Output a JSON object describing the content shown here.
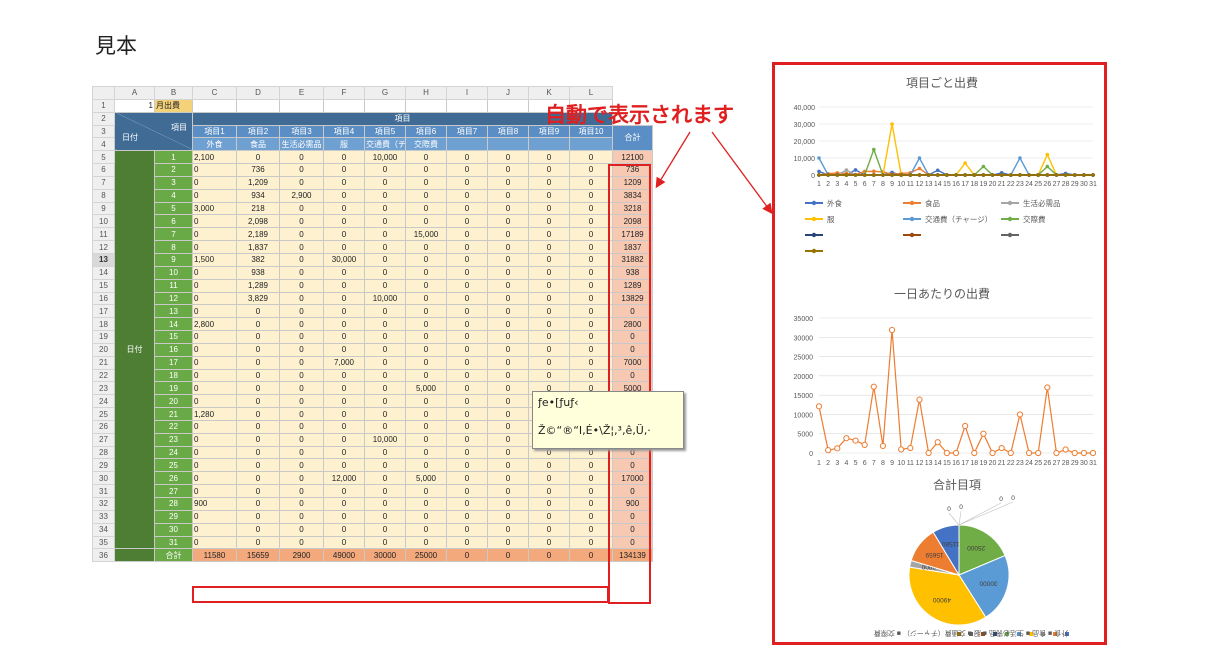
{
  "page_title": "見本",
  "annotation": "自動で表示されます",
  "sheet": {
    "col_headers": [
      "A",
      "B",
      "C",
      "D",
      "E",
      "F",
      "G",
      "H",
      "I",
      "J",
      "K",
      "L"
    ],
    "row1": {
      "a": "1",
      "b": "月出費"
    },
    "header": {
      "date": "日付",
      "item": "項目",
      "group": "項目",
      "total": "合計"
    },
    "items": [
      "項目1",
      "項目2",
      "項目3",
      "項目4",
      "項目5",
      "項目6",
      "項目7",
      "項目8",
      "項目9",
      "項目10"
    ],
    "item_names": [
      "外食",
      "食品",
      "生活必需品",
      "服",
      "交通費（チャージ）",
      "交際費",
      "",
      "",
      "",
      ""
    ],
    "side_label": "日付",
    "days": [
      {
        "row": "5",
        "day": "1",
        "v": [
          "2,100",
          "0",
          "0",
          "0",
          "10,000",
          "0",
          "0",
          "0",
          "0",
          "0"
        ],
        "total": "12100"
      },
      {
        "row": "6",
        "day": "2",
        "v": [
          "0",
          "736",
          "0",
          "0",
          "0",
          "0",
          "0",
          "0",
          "0",
          "0"
        ],
        "total": "736"
      },
      {
        "row": "7",
        "day": "3",
        "v": [
          "0",
          "1,209",
          "0",
          "0",
          "0",
          "0",
          "0",
          "0",
          "0",
          "0"
        ],
        "total": "1209"
      },
      {
        "row": "8",
        "day": "4",
        "v": [
          "0",
          "934",
          "2,900",
          "0",
          "0",
          "0",
          "0",
          "0",
          "0",
          "0"
        ],
        "total": "3834"
      },
      {
        "row": "9",
        "day": "5",
        "v": [
          "3,000",
          "218",
          "0",
          "0",
          "0",
          "0",
          "0",
          "0",
          "0",
          "0"
        ],
        "total": "3218"
      },
      {
        "row": "10",
        "day": "6",
        "v": [
          "0",
          "2,098",
          "0",
          "0",
          "0",
          "0",
          "0",
          "0",
          "0",
          "0"
        ],
        "total": "2098"
      },
      {
        "row": "11",
        "day": "7",
        "v": [
          "0",
          "2,189",
          "0",
          "0",
          "0",
          "15,000",
          "0",
          "0",
          "0",
          "0"
        ],
        "total": "17189"
      },
      {
        "row": "12",
        "day": "8",
        "v": [
          "0",
          "1,837",
          "0",
          "0",
          "0",
          "0",
          "0",
          "0",
          "0",
          "0"
        ],
        "total": "1837"
      },
      {
        "row": "13",
        "day": "9",
        "v": [
          "1,500",
          "382",
          "0",
          "30,000",
          "0",
          "0",
          "0",
          "0",
          "0",
          "0"
        ],
        "total": "31882"
      },
      {
        "row": "14",
        "day": "10",
        "v": [
          "0",
          "938",
          "0",
          "0",
          "0",
          "0",
          "0",
          "0",
          "0",
          "0"
        ],
        "total": "938"
      },
      {
        "row": "15",
        "day": "11",
        "v": [
          "0",
          "1,289",
          "0",
          "0",
          "0",
          "0",
          "0",
          "0",
          "0",
          "0"
        ],
        "total": "1289"
      },
      {
        "row": "16",
        "day": "12",
        "v": [
          "0",
          "3,829",
          "0",
          "0",
          "10,000",
          "0",
          "0",
          "0",
          "0",
          "0"
        ],
        "total": "13829"
      },
      {
        "row": "17",
        "day": "13",
        "v": [
          "0",
          "0",
          "0",
          "0",
          "0",
          "0",
          "0",
          "0",
          "0",
          "0"
        ],
        "total": "0"
      },
      {
        "row": "18",
        "day": "14",
        "v": [
          "2,800",
          "0",
          "0",
          "0",
          "0",
          "0",
          "0",
          "0",
          "0",
          "0"
        ],
        "total": "2800"
      },
      {
        "row": "19",
        "day": "15",
        "v": [
          "0",
          "0",
          "0",
          "0",
          "0",
          "0",
          "0",
          "0",
          "0",
          "0"
        ],
        "total": "0"
      },
      {
        "row": "20",
        "day": "16",
        "v": [
          "0",
          "0",
          "0",
          "0",
          "0",
          "0",
          "0",
          "0",
          "0",
          "0"
        ],
        "total": "0"
      },
      {
        "row": "21",
        "day": "17",
        "v": [
          "0",
          "0",
          "0",
          "7,000",
          "0",
          "0",
          "0",
          "0",
          "0",
          "0"
        ],
        "total": "7000"
      },
      {
        "row": "22",
        "day": "18",
        "v": [
          "0",
          "0",
          "0",
          "0",
          "0",
          "0",
          "0",
          "0",
          "0",
          "0"
        ],
        "total": "0"
      },
      {
        "row": "23",
        "day": "19",
        "v": [
          "0",
          "0",
          "0",
          "0",
          "0",
          "5,000",
          "0",
          "0",
          "0",
          "0"
        ],
        "total": "5000"
      },
      {
        "row": "24",
        "day": "20",
        "v": [
          "0",
          "0",
          "0",
          "0",
          "0",
          "0",
          "0",
          "0",
          "0",
          "0"
        ],
        "total": "0"
      },
      {
        "row": "25",
        "day": "21",
        "v": [
          "1,280",
          "0",
          "0",
          "0",
          "0",
          "0",
          "0",
          "0",
          "0",
          "0"
        ],
        "total": "1280"
      },
      {
        "row": "26",
        "day": "22",
        "v": [
          "0",
          "0",
          "0",
          "0",
          "0",
          "0",
          "0",
          "0",
          "0",
          "0"
        ],
        "total": "0"
      },
      {
        "row": "27",
        "day": "23",
        "v": [
          "0",
          "0",
          "0",
          "0",
          "10,000",
          "0",
          "0",
          "0",
          "0",
          "0"
        ],
        "total": "10000"
      },
      {
        "row": "28",
        "day": "24",
        "v": [
          "0",
          "0",
          "0",
          "0",
          "0",
          "0",
          "0",
          "0",
          "0",
          "0"
        ],
        "total": "0"
      },
      {
        "row": "29",
        "day": "25",
        "v": [
          "0",
          "0",
          "0",
          "0",
          "0",
          "0",
          "0",
          "0",
          "0",
          "0"
        ],
        "total": "0"
      },
      {
        "row": "30",
        "day": "26",
        "v": [
          "0",
          "0",
          "0",
          "12,000",
          "0",
          "5,000",
          "0",
          "0",
          "0",
          "0"
        ],
        "total": "17000"
      },
      {
        "row": "31",
        "day": "27",
        "v": [
          "0",
          "0",
          "0",
          "0",
          "0",
          "0",
          "0",
          "0",
          "0",
          "0"
        ],
        "total": "0"
      },
      {
        "row": "32",
        "day": "28",
        "v": [
          "900",
          "0",
          "0",
          "0",
          "0",
          "0",
          "0",
          "0",
          "0",
          "0"
        ],
        "total": "900"
      },
      {
        "row": "33",
        "day": "29",
        "v": [
          "0",
          "0",
          "0",
          "0",
          "0",
          "0",
          "0",
          "0",
          "0",
          "0"
        ],
        "total": "0"
      },
      {
        "row": "34",
        "day": "30",
        "v": [
          "0",
          "0",
          "0",
          "0",
          "0",
          "0",
          "0",
          "0",
          "0",
          "0"
        ],
        "total": "0"
      },
      {
        "row": "35",
        "day": "31",
        "v": [
          "0",
          "0",
          "0",
          "0",
          "0",
          "0",
          "0",
          "0",
          "0",
          "0"
        ],
        "total": "0"
      }
    ],
    "totals_row": {
      "row": "36",
      "label": "合計",
      "v": [
        "11580",
        "15659",
        "2900",
        "49000",
        "30000",
        "25000",
        "0",
        "0",
        "0",
        "0"
      ],
      "total": "134139"
    }
  },
  "comment": {
    "line1": "ƒe•[ƒuƒ‹",
    "line2": "Ž©“®“I‚É•\\Ž¦‚³‚ê‚Ü‚·"
  },
  "chart_data": [
    {
      "type": "line",
      "title": "項目ごと出費",
      "x": [
        "1",
        "2",
        "3",
        "4",
        "5",
        "6",
        "7",
        "8",
        "9",
        "10",
        "11",
        "12",
        "13",
        "14",
        "15",
        "16",
        "17",
        "18",
        "19",
        "20",
        "21",
        "22",
        "23",
        "24",
        "25",
        "26",
        "27",
        "28",
        "29",
        "30",
        "31"
      ],
      "ylim": [
        0,
        40000
      ],
      "yticks": [
        "0",
        "10,000",
        "20,000",
        "30,000",
        "40,000"
      ],
      "grid": true,
      "legend": "bottom",
      "series": [
        {
          "name": "外食",
          "color": "#4472c4",
          "values": [
            2100,
            0,
            0,
            0,
            3000,
            0,
            0,
            0,
            1500,
            0,
            0,
            0,
            0,
            2800,
            0,
            0,
            0,
            0,
            0,
            0,
            1280,
            0,
            0,
            0,
            0,
            0,
            0,
            900,
            0,
            0,
            0
          ]
        },
        {
          "name": "食品",
          "color": "#ed7d31",
          "values": [
            0,
            736,
            1209,
            934,
            218,
            2098,
            2189,
            1837,
            382,
            938,
            1289,
            3829,
            0,
            0,
            0,
            0,
            0,
            0,
            0,
            0,
            0,
            0,
            0,
            0,
            0,
            0,
            0,
            0,
            0,
            0,
            0
          ]
        },
        {
          "name": "生活必需品",
          "color": "#a5a5a5",
          "values": [
            0,
            0,
            0,
            2900,
            0,
            0,
            0,
            0,
            0,
            0,
            0,
            0,
            0,
            0,
            0,
            0,
            0,
            0,
            0,
            0,
            0,
            0,
            0,
            0,
            0,
            0,
            0,
            0,
            0,
            0,
            0
          ]
        },
        {
          "name": "服",
          "color": "#ffc000",
          "values": [
            0,
            0,
            0,
            0,
            0,
            0,
            0,
            0,
            30000,
            0,
            0,
            0,
            0,
            0,
            0,
            0,
            7000,
            0,
            0,
            0,
            0,
            0,
            0,
            0,
            0,
            12000,
            0,
            0,
            0,
            0,
            0
          ]
        },
        {
          "name": "交通費（チャージ）",
          "color": "#5b9bd5",
          "values": [
            10000,
            0,
            0,
            0,
            0,
            0,
            0,
            0,
            0,
            0,
            0,
            10000,
            0,
            0,
            0,
            0,
            0,
            0,
            0,
            0,
            0,
            0,
            10000,
            0,
            0,
            0,
            0,
            0,
            0,
            0,
            0
          ]
        },
        {
          "name": "交際費",
          "color": "#70ad47",
          "values": [
            0,
            0,
            0,
            0,
            0,
            0,
            15000,
            0,
            0,
            0,
            0,
            0,
            0,
            0,
            0,
            0,
            0,
            0,
            5000,
            0,
            0,
            0,
            0,
            0,
            0,
            5000,
            0,
            0,
            0,
            0,
            0
          ]
        },
        {
          "color": "#264478",
          "values": [
            0,
            0,
            0,
            0,
            0,
            0,
            0,
            0,
            0,
            0,
            0,
            0,
            0,
            0,
            0,
            0,
            0,
            0,
            0,
            0,
            0,
            0,
            0,
            0,
            0,
            0,
            0,
            0,
            0,
            0,
            0
          ]
        },
        {
          "color": "#9e480e",
          "values": [
            0,
            0,
            0,
            0,
            0,
            0,
            0,
            0,
            0,
            0,
            0,
            0,
            0,
            0,
            0,
            0,
            0,
            0,
            0,
            0,
            0,
            0,
            0,
            0,
            0,
            0,
            0,
            0,
            0,
            0,
            0
          ]
        },
        {
          "color": "#636363",
          "values": [
            0,
            0,
            0,
            0,
            0,
            0,
            0,
            0,
            0,
            0,
            0,
            0,
            0,
            0,
            0,
            0,
            0,
            0,
            0,
            0,
            0,
            0,
            0,
            0,
            0,
            0,
            0,
            0,
            0,
            0,
            0
          ]
        },
        {
          "color": "#997300",
          "values": [
            0,
            0,
            0,
            0,
            0,
            0,
            0,
            0,
            0,
            0,
            0,
            0,
            0,
            0,
            0,
            0,
            0,
            0,
            0,
            0,
            0,
            0,
            0,
            0,
            0,
            0,
            0,
            0,
            0,
            0,
            0
          ]
        }
      ]
    },
    {
      "type": "line",
      "title": "一日あたりの出費",
      "x": [
        "1",
        "2",
        "3",
        "4",
        "5",
        "6",
        "7",
        "8",
        "9",
        "10",
        "11",
        "12",
        "13",
        "14",
        "15",
        "16",
        "17",
        "18",
        "19",
        "20",
        "21",
        "22",
        "23",
        "24",
        "25",
        "26",
        "27",
        "28",
        "29",
        "30",
        "31"
      ],
      "ylim": [
        0,
        35000
      ],
      "yticks": [
        "0",
        "5000",
        "10000",
        "15000",
        "20000",
        "25000",
        "30000",
        "35000"
      ],
      "grid": true,
      "color": "#ed7d31",
      "values": [
        12100,
        736,
        1209,
        3834,
        3218,
        2098,
        17189,
        1837,
        31882,
        938,
        1289,
        13829,
        0,
        2800,
        0,
        0,
        7000,
        0,
        5000,
        0,
        1280,
        0,
        10000,
        0,
        0,
        17000,
        0,
        900,
        0,
        0,
        0
      ]
    },
    {
      "type": "pie",
      "title": "合計目項",
      "labels": [
        "外食",
        "食品",
        "生活必需品",
        "服",
        "交通費（チャージ）",
        "交際費",
        "",
        "",
        "",
        ""
      ],
      "values": [
        11580,
        15659,
        2900,
        49000,
        30000,
        25000,
        0,
        0,
        0,
        0
      ],
      "data_labels": [
        "11580",
        "15659",
        "2900",
        "49000",
        "30000",
        "25000",
        "0",
        "0",
        "0",
        "0"
      ],
      "colors": [
        "#4472c4",
        "#ed7d31",
        "#a5a5a5",
        "#ffc000",
        "#5b9bd5",
        "#70ad47",
        "#264478",
        "#9e480e",
        "#636363",
        "#997300"
      ],
      "legend": "bottom",
      "legend_text": [
        "外食",
        "食品",
        "生活必需品",
        "服",
        "交通費（チャージ）",
        "交際費"
      ]
    }
  ]
}
